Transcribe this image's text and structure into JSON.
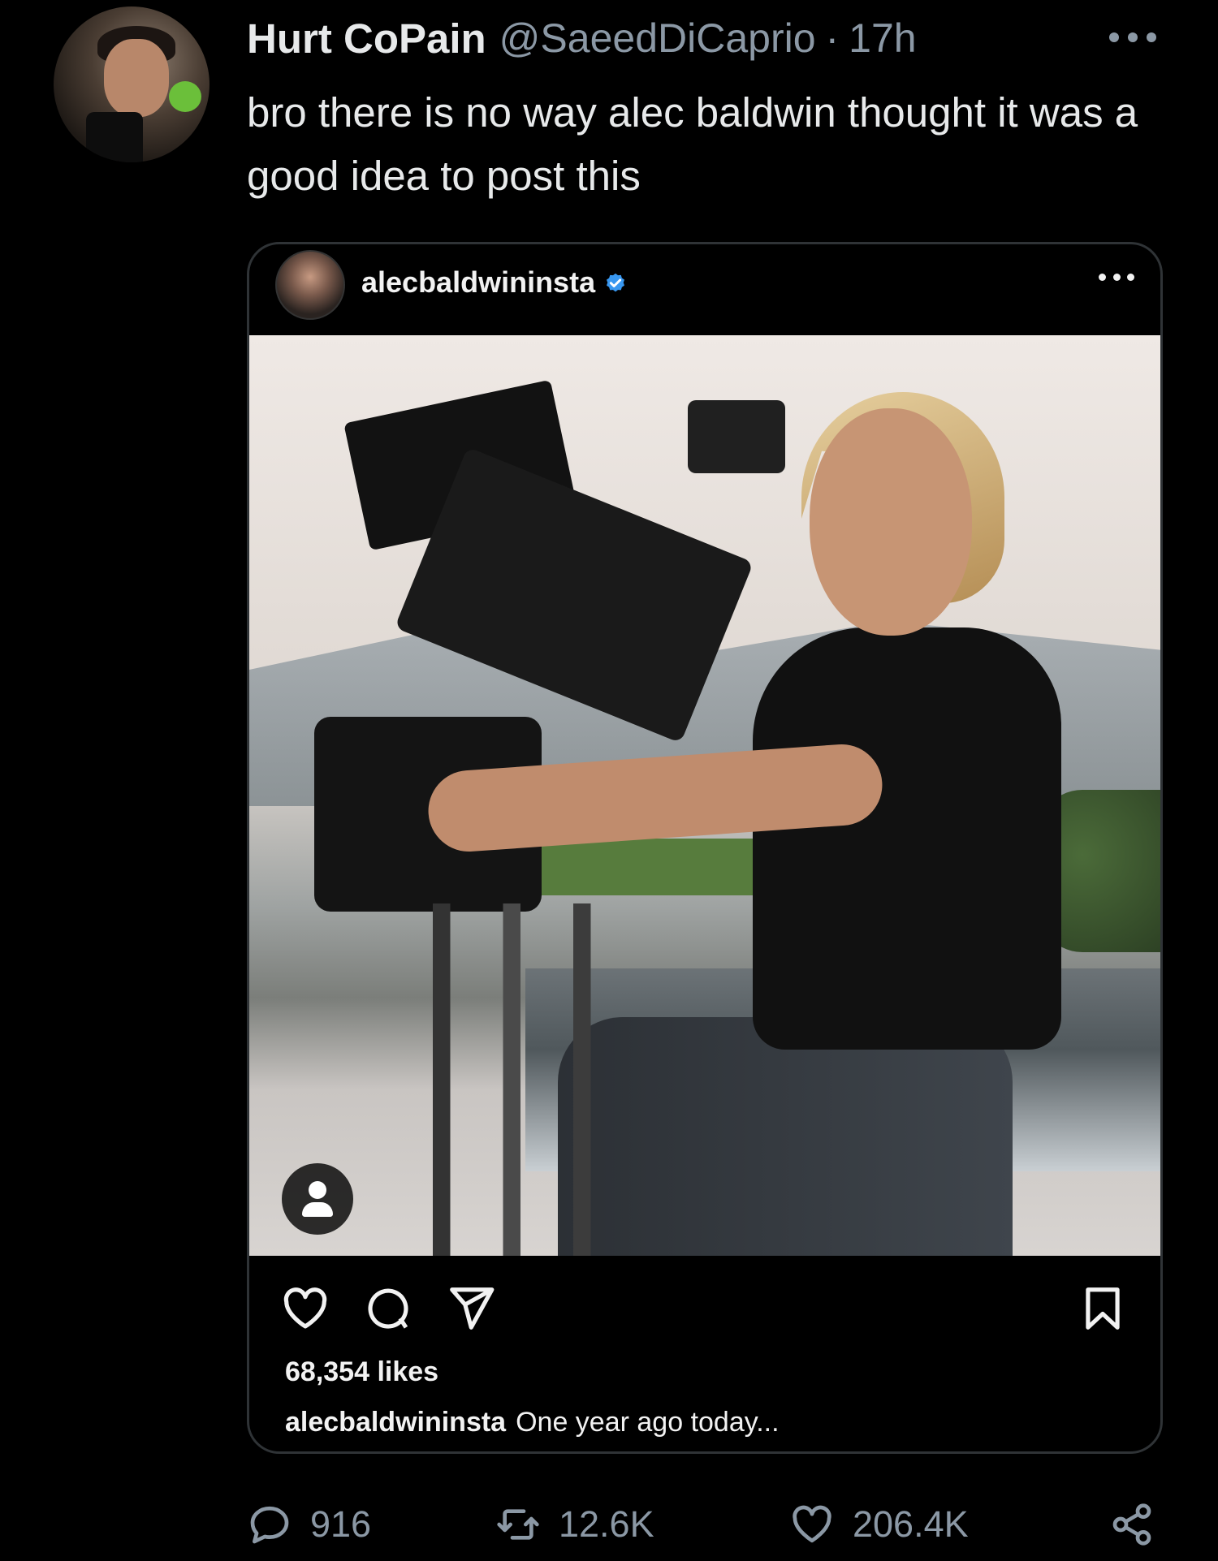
{
  "tweet": {
    "display_name": "Hurt CoPain",
    "handle": "@SaeedDiCaprio",
    "separator": "·",
    "time": "17h",
    "text": "bro there is no way alec baldwin thought it was a good idea to post this"
  },
  "embed": {
    "username": "alecbaldwininsta",
    "likes": "68,354 likes",
    "caption_user": "alecbaldwininsta",
    "caption_text": "One year ago today..."
  },
  "actions": {
    "replies": "916",
    "retweets": "12.6K",
    "likes": "206.4K"
  },
  "colors": {
    "background": "#000000",
    "text": "#e7e9ea",
    "secondary_text": "#8b98a5",
    "verified": "#3897f0",
    "card_border": "#2f3336"
  }
}
